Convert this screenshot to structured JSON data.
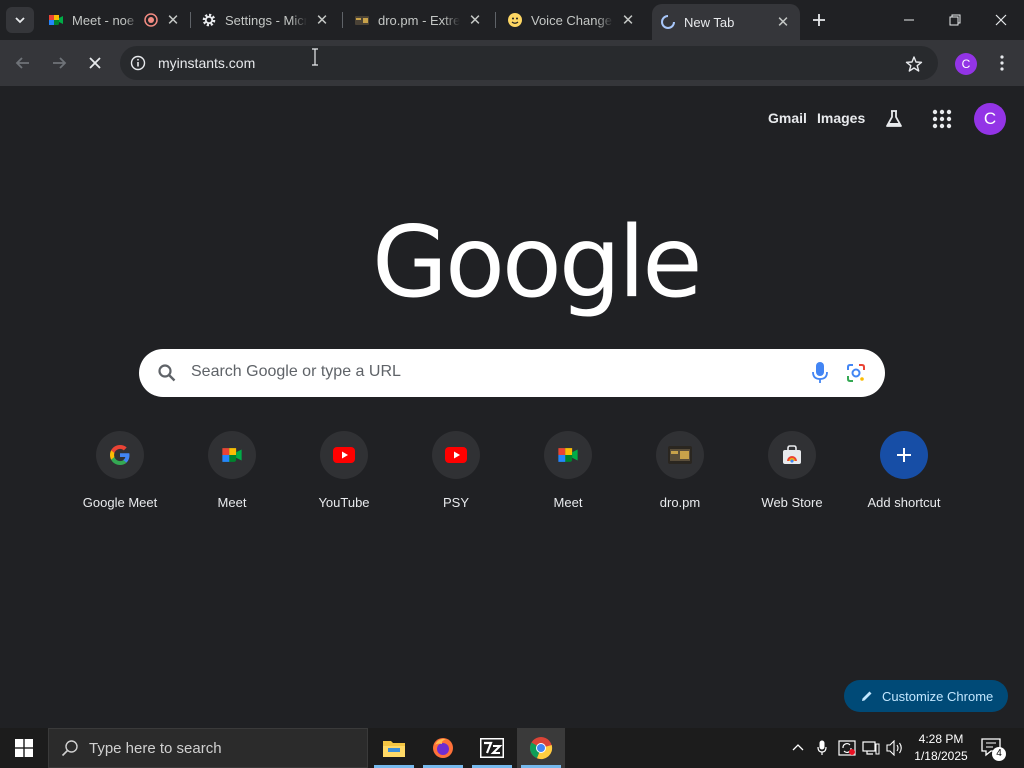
{
  "tabs": [
    {
      "title": "Meet - noe",
      "icon": "google-meet-icon",
      "recording": true
    },
    {
      "title": "Settings - Micr",
      "icon": "gear-icon",
      "recording": false
    },
    {
      "title": "dro.pm - Extren",
      "icon": "dropm-icon",
      "recording": false
    },
    {
      "title": "Voice Changer",
      "icon": "voice-changer-icon",
      "recording": false
    },
    {
      "title": "New Tab",
      "icon": "loading-spinner-icon",
      "recording": false,
      "active": true
    }
  ],
  "toolbar": {
    "url": "myinstants.com",
    "profile_initial": "C"
  },
  "ntp": {
    "gmail_label": "Gmail",
    "images_label": "Images",
    "logo_text": "Google",
    "search_placeholder": "Search Google or type a URL",
    "profile_initial": "C",
    "shortcuts": [
      {
        "label": "Google Meet",
        "icon": "google-g-icon"
      },
      {
        "label": "Meet",
        "icon": "google-meet-icon"
      },
      {
        "label": "YouTube",
        "icon": "youtube-icon"
      },
      {
        "label": "PSY",
        "icon": "youtube-icon"
      },
      {
        "label": "Meet",
        "icon": "google-meet-icon"
      },
      {
        "label": "dro.pm",
        "icon": "dropm-icon"
      },
      {
        "label": "Web Store",
        "icon": "web-store-icon"
      },
      {
        "label": "Add shortcut",
        "icon": "plus-icon"
      }
    ],
    "customize_label": "Customize Chrome"
  },
  "taskbar": {
    "search_placeholder": "Type here to search",
    "apps": [
      "file-explorer-icon",
      "firefox-icon",
      "7zip-icon",
      "chrome-icon"
    ],
    "time": "4:28 PM",
    "date": "1/18/2025",
    "notification_count": "4"
  },
  "colors": {
    "background": "#202124",
    "toolbar": "#35363a",
    "accent": "#9334e6",
    "customize_bg": "#004a77",
    "add_shortcut": "#174ea6"
  }
}
